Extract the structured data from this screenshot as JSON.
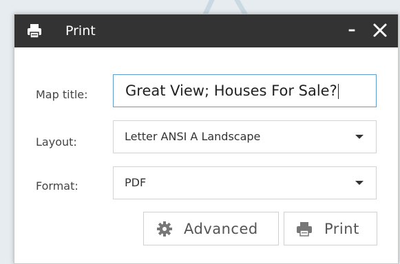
{
  "window": {
    "title": "Print",
    "icon": "printer-icon",
    "minimize_label": "–",
    "close_icon": "close-icon"
  },
  "form": {
    "map_title": {
      "label": "Map title:",
      "value": "Great View; Houses For Sale?"
    },
    "layout": {
      "label": "Layout:",
      "value": "Letter ANSI A Landscape"
    },
    "format": {
      "label": "Format:",
      "value": "PDF"
    }
  },
  "buttons": {
    "advanced": {
      "label": "Advanced",
      "icon": "gear-icon"
    },
    "print": {
      "label": "Print",
      "icon": "printer-icon"
    }
  },
  "colors": {
    "titlebar": "#333333",
    "focus_border": "#5c9ccf"
  }
}
